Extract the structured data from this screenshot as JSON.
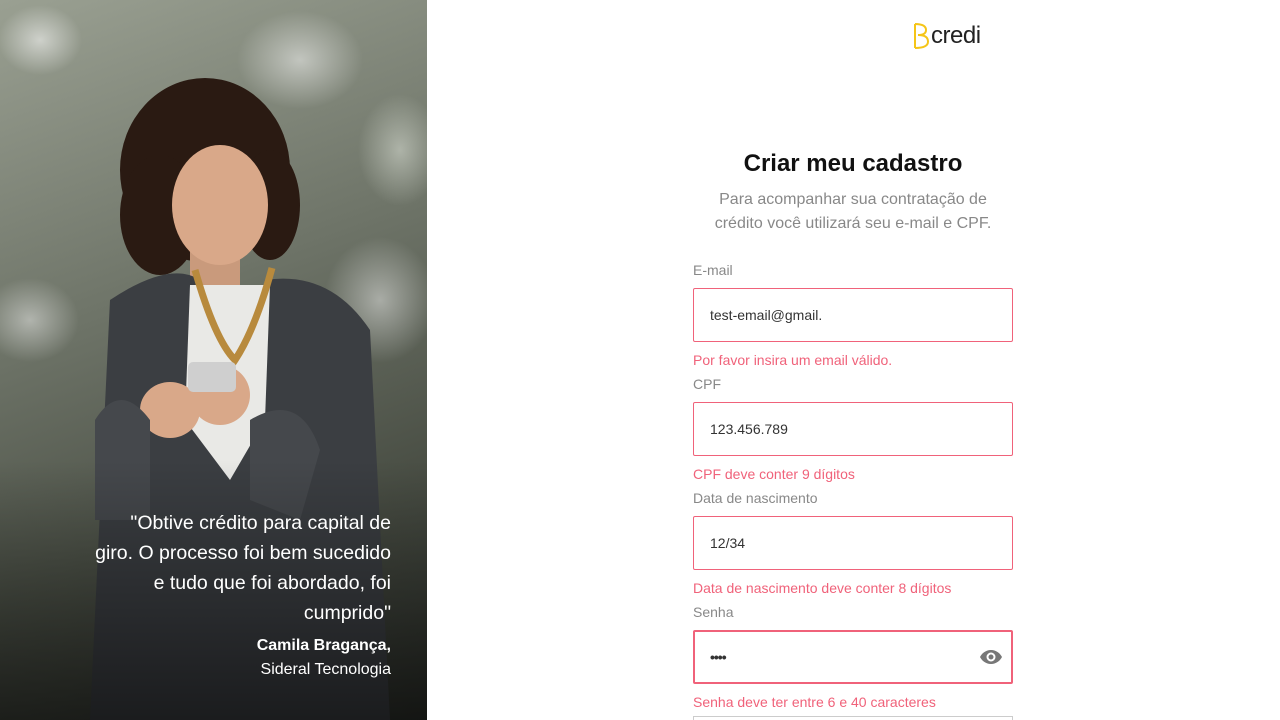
{
  "brand": {
    "logo_text": "credi",
    "logo_color": "#f5c518"
  },
  "hero": {
    "quote": "\"Obtive crédito para capital de giro. O processo foi bem sucedido e tudo que foi abordado, foi cumprido\"",
    "author_name": "Camila Bragança,",
    "author_company": "Sideral Tecnologia"
  },
  "form": {
    "title": "Criar meu cadastro",
    "subtitle": "Para acompanhar sua contratação de crédito você utilizará seu e-mail e CPF.",
    "email": {
      "label": "E-mail",
      "value": "test-email@gmail.",
      "error": "Por favor insira um email válido."
    },
    "cpf": {
      "label": "CPF",
      "value": "123.456.789",
      "error": "CPF deve conter 9 dígitos"
    },
    "birthdate": {
      "label": "Data de nascimento",
      "value": "12/34",
      "error": "Data de nascimento deve conter 8 dígitos"
    },
    "password": {
      "label": "Senha",
      "value": "••••",
      "error": "Senha deve ter entre 6 e 40 caracteres",
      "toggle_icon": "eye-icon"
    }
  },
  "colors": {
    "error": "#f0627a",
    "label": "#888888",
    "title": "#111111"
  }
}
